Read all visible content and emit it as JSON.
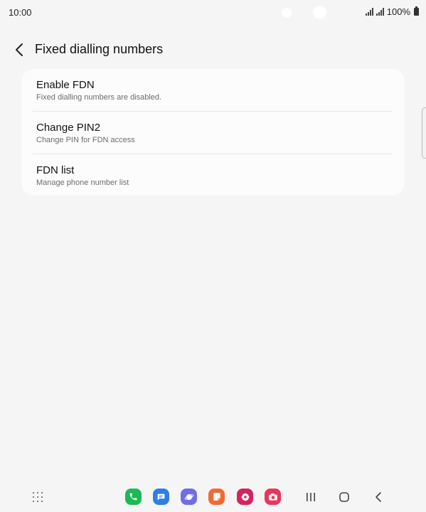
{
  "status_bar": {
    "time": "10:00",
    "battery_text": "100%",
    "icons": [
      "signal-icon",
      "signal-icon",
      "battery-icon"
    ]
  },
  "header": {
    "back_icon": "chevron-left-icon",
    "title": "Fixed dialling numbers"
  },
  "settings": {
    "items": [
      {
        "title": "Enable FDN",
        "subtitle": "Fixed dialling numbers are disabled."
      },
      {
        "title": "Change PIN2",
        "subtitle": "Change PIN for FDN access"
      },
      {
        "title": "FDN list",
        "subtitle": "Manage phone number list"
      }
    ]
  },
  "nav_bar": {
    "apps_icon": "apps-grid-icon",
    "dock": [
      {
        "name": "phone-app-icon",
        "color": "#1db954"
      },
      {
        "name": "messages-app-icon",
        "color": "#2f7ee6"
      },
      {
        "name": "internet-app-icon",
        "color": "#6e6ee6"
      },
      {
        "name": "notes-app-icon",
        "color": "#f06a34"
      },
      {
        "name": "gallery-app-icon",
        "color": "#d4245d"
      },
      {
        "name": "camera-app-icon",
        "color": "#e8365a"
      }
    ],
    "buttons": [
      "recents-icon",
      "home-icon",
      "back-icon"
    ]
  }
}
